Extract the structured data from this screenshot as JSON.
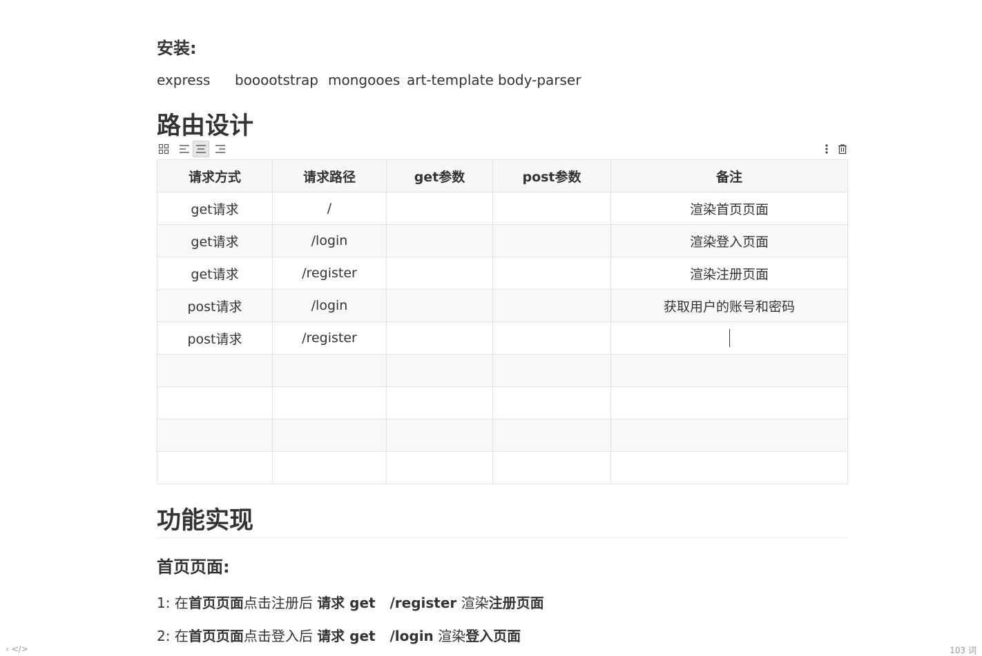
{
  "install": {
    "heading": "安装:",
    "packages": [
      "express",
      "booootstrap",
      "mongooes",
      "art-template",
      "body-parser"
    ]
  },
  "routes": {
    "heading": "路由设计",
    "toolbar": {
      "icons": [
        "grid-icon",
        "align-left-icon",
        "align-center-icon",
        "align-right-icon",
        "more-icon",
        "trash-icon"
      ]
    },
    "table": {
      "headers": [
        "请求方式",
        "请求路径",
        "get参数",
        "post参数",
        "备注"
      ],
      "rows": [
        [
          "get请求",
          "/",
          "",
          "",
          "渲染首页页面"
        ],
        [
          "get请求",
          "/login",
          "",
          "",
          "渲染登入页面"
        ],
        [
          "get请求",
          "/register",
          "",
          "",
          "渲染注册页面"
        ],
        [
          "post请求",
          "/login",
          "",
          "",
          "获取用户的账号和密码"
        ],
        [
          "post请求",
          "/register",
          "",
          "",
          ""
        ],
        [
          "",
          "",
          "",
          "",
          ""
        ],
        [
          "",
          "",
          "",
          "",
          ""
        ],
        [
          "",
          "",
          "",
          "",
          ""
        ],
        [
          "",
          "",
          "",
          "",
          ""
        ]
      ]
    }
  },
  "features": {
    "heading": "功能实现",
    "subheading": "首页页面:",
    "lines": [
      {
        "p1": "1: 在",
        "b1": "首页页面",
        "p2": "点击注册后 ",
        "b2": "请求 get   /register",
        "p3": " 渲染",
        "b3": "注册页面"
      },
      {
        "p1": "2: 在",
        "b1": "首页页面",
        "p2": "点击登入后 ",
        "b2": "请求 get   /login",
        "p3": " 渲染",
        "b3": "登入页面"
      }
    ]
  },
  "footer": {
    "left": "‹ </>",
    "right": "103 词"
  }
}
